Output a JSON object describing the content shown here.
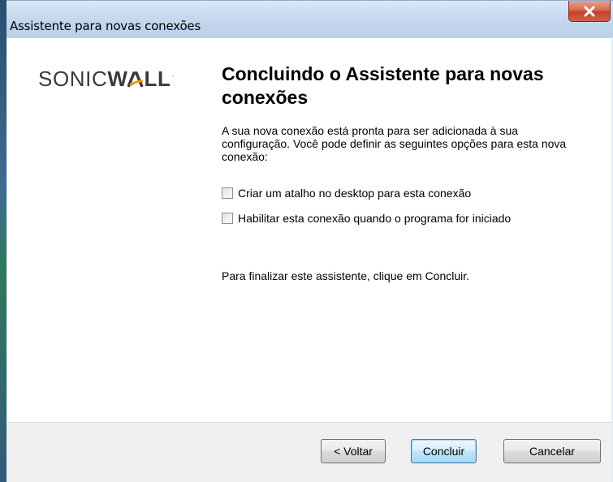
{
  "window": {
    "title": "Assistente para novas conexões",
    "close_icon": "close-icon"
  },
  "logo": {
    "text_light": "SONIC",
    "text_bold_1": "W",
    "text_bold_a": "A",
    "text_bold_2": "LL",
    "trademark": "·"
  },
  "main": {
    "heading": "Concluindo o Assistente para novas conexões",
    "description": "A sua nova conexão está pronta para ser adicionada à sua configuração. Você pode definir as seguintes opções para esta nova conexão:",
    "options": [
      {
        "label": "Criar um atalho no desktop para esta conexão",
        "checked": false
      },
      {
        "label": "Habilitar esta conexão quando o programa for iniciado",
        "checked": false
      }
    ],
    "finish_text": "Para finalizar este assistente, clique em Concluir."
  },
  "footer": {
    "back_label": "< Voltar",
    "finish_label": "Concluir",
    "cancel_label": "Cancelar"
  },
  "colors": {
    "logo_accent": "#f2941c",
    "titlebar": "#c6d9ef",
    "close_button": "#c3432a"
  }
}
